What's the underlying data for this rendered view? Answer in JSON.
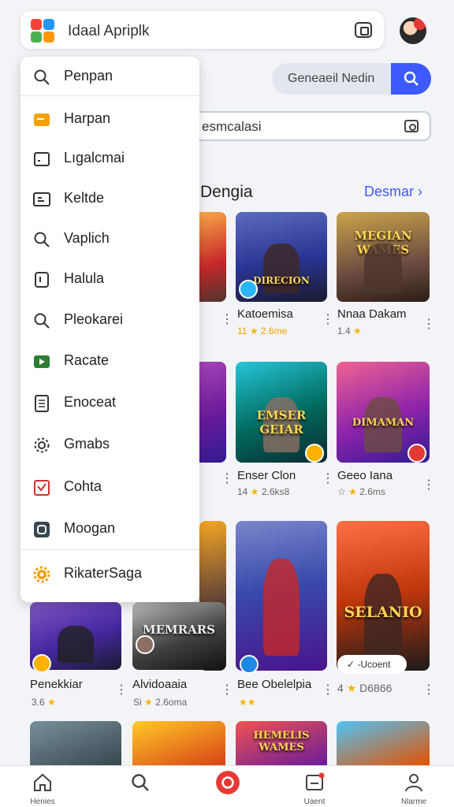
{
  "app": {
    "title": "Idaal Apriplk"
  },
  "search": {
    "label": "Geneaeil Nedin"
  },
  "field": {
    "value": "esmcalasi"
  },
  "section": {
    "title": "Dengia",
    "link": "Desmar"
  },
  "drawer": {
    "items": [
      {
        "label": "Penpan",
        "icon": "search-icon"
      },
      {
        "label": "Harpan",
        "icon": "folder-icon"
      },
      {
        "label": "Lıgalcmai",
        "icon": "file-icon"
      },
      {
        "label": "Keltde",
        "icon": "list-icon"
      },
      {
        "label": "Vaplich",
        "icon": "search-icon"
      },
      {
        "label": "Halula",
        "icon": "page-icon"
      },
      {
        "label": "Pleokarei",
        "icon": "search-icon"
      },
      {
        "label": "Racate",
        "icon": "play-icon"
      },
      {
        "label": "Enoceat",
        "icon": "document-icon"
      },
      {
        "label": "Gmabs",
        "icon": "settings-icon"
      },
      {
        "label": "Cohta",
        "icon": "checkbox-icon"
      },
      {
        "label": "Moogan",
        "icon": "tag-icon"
      },
      {
        "label": "RikaterSaga",
        "icon": "gear-icon"
      }
    ]
  },
  "games": [
    {
      "name": "Katoemisa",
      "rating": "11",
      "score": "2.6me",
      "art": "DIRECION"
    },
    {
      "name": "Nnaa Dakam",
      "rating": "1.4",
      "score": "",
      "art": "MEGIAN WAMES"
    },
    {
      "name": "Enser Clon",
      "rating": "14",
      "score": "2.6ks8",
      "art": "EMSER GEIAR"
    },
    {
      "name": "Geeo Iana",
      "rating": "",
      "score": "2.6ms",
      "art": "DIMAMAN"
    },
    {
      "name": "Penekkiar",
      "rating": "3.6",
      "score": "",
      "art": ""
    },
    {
      "name": "Alvidoaaia",
      "rating": "Si",
      "score": "2.6oma",
      "art": "MEMRARS"
    },
    {
      "name": "Bee Obelelpia",
      "rating": "",
      "score": "",
      "art": ""
    },
    {
      "name": "-Ucoent",
      "rating": "4",
      "score": "D6866",
      "art": "SELANIO"
    },
    {
      "name": "",
      "rating": "",
      "score": "",
      "art": "HEMELIS WAMES"
    }
  ],
  "nav": [
    {
      "label": "Henies",
      "icon": "home-icon"
    },
    {
      "label": "",
      "icon": "search-icon"
    },
    {
      "label": "",
      "icon": "record-icon"
    },
    {
      "label": "Uaent",
      "icon": "inbox-icon"
    },
    {
      "label": "Nlarme",
      "icon": "profile-icon"
    }
  ]
}
